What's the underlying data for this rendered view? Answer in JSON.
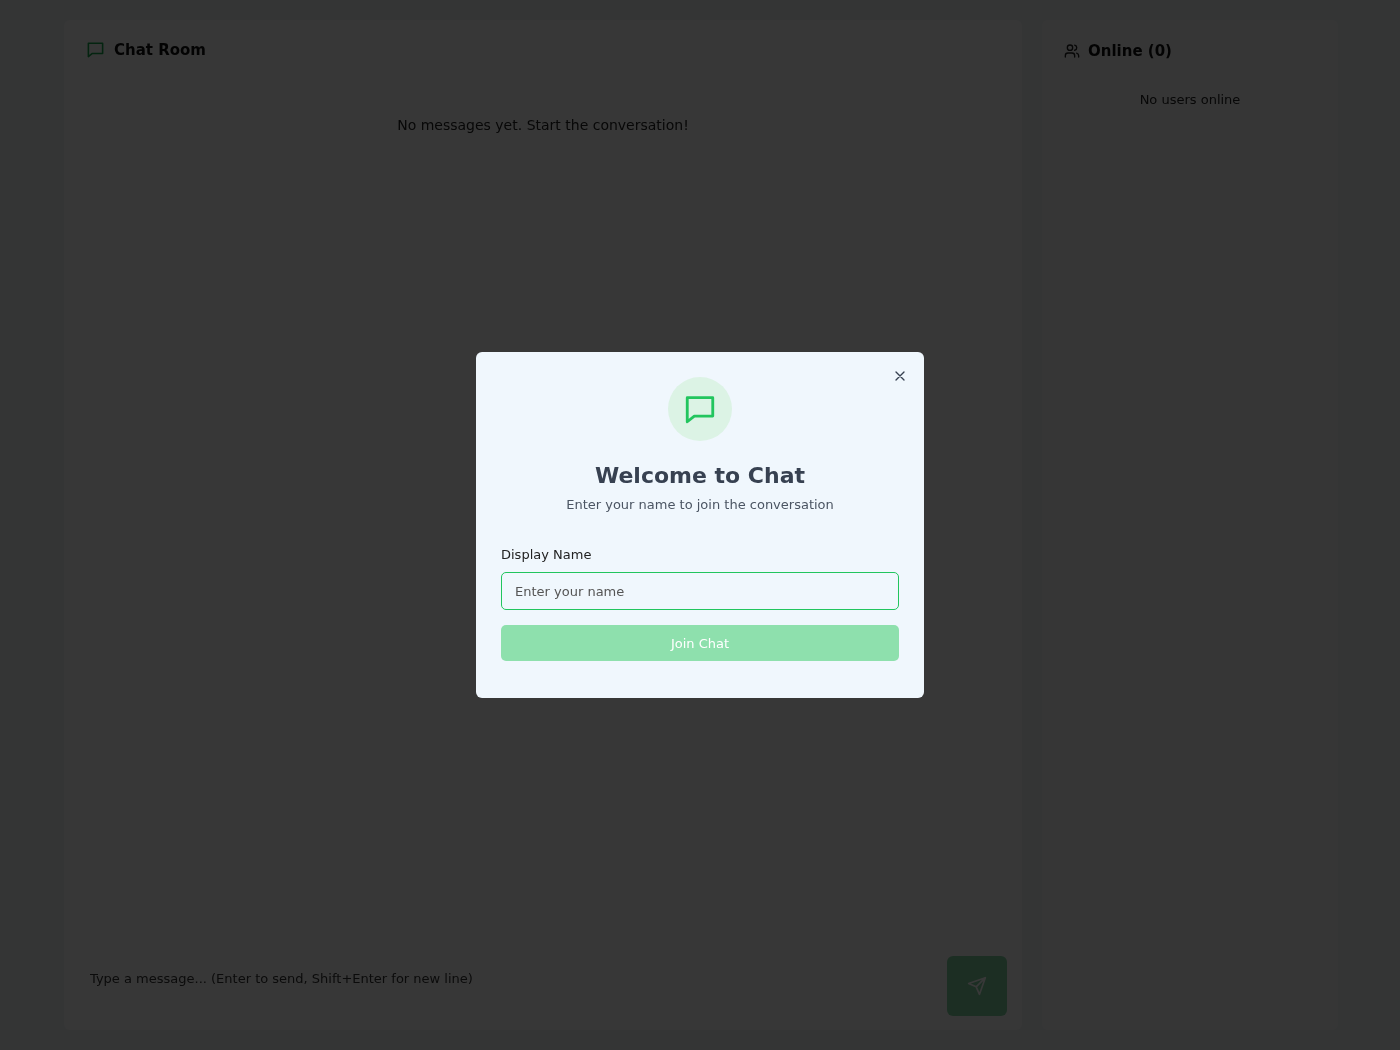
{
  "chat": {
    "title": "Chat Room",
    "empty_message": "No messages yet. Start the conversation!",
    "composer": {
      "placeholder": "Type a message... (Enter to send, Shift+Enter for new line)"
    },
    "send_button": {
      "disabled": true
    }
  },
  "sidebar": {
    "title": "Online (0)",
    "empty_message": "No users online"
  },
  "dialog": {
    "title": "Welcome to Chat",
    "subtitle": "Enter your name to join the conversation",
    "field_label": "Display Name",
    "field": {
      "placeholder": "Enter your name"
    },
    "join_button": {
      "label": "Join Chat",
      "disabled": true
    }
  }
}
